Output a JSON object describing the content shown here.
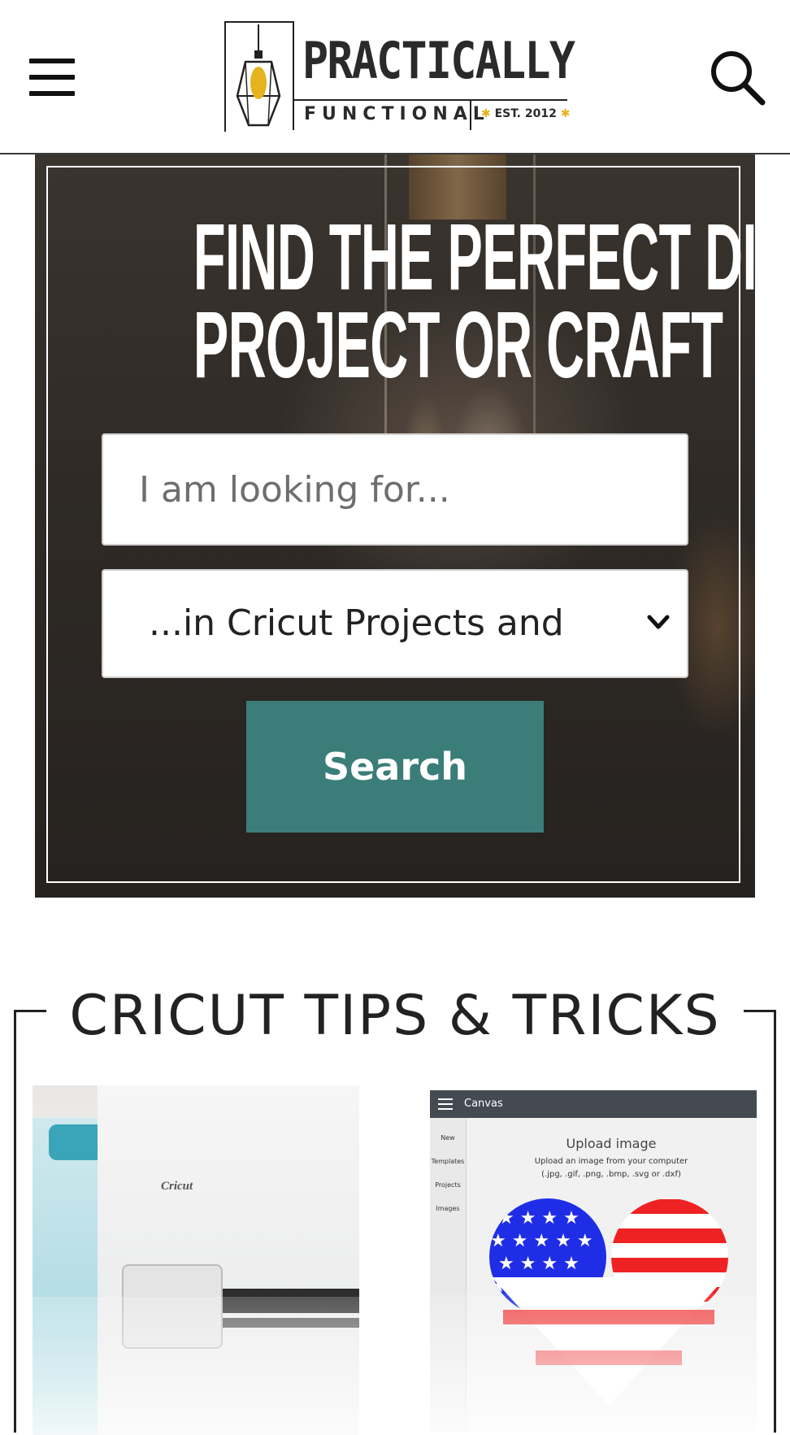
{
  "header": {
    "logo": {
      "title": "PRACTICALLY",
      "subtitle": "FUNCTIONAL",
      "established": "EST. 2012"
    },
    "colors": {
      "logo_accent": "#e6b31e",
      "text": "#2a2a2a"
    }
  },
  "hero": {
    "title_line1": "FIND THE PERFECT DIY",
    "title_line2": "PROJECT OR CRAFT",
    "search_placeholder": "I am looking for...",
    "category_select": "...in Cricut Projects and",
    "search_button": "Search",
    "colors": {
      "button": "#3b7d79"
    }
  },
  "section": {
    "title": "CRICUT TIPS & TRICKS",
    "card1": {
      "machine_brand": "Cricut"
    },
    "card2": {
      "app_bar_title": "Canvas",
      "sidebar": [
        "New",
        "Templates",
        "Projects",
        "Images"
      ],
      "upload_title": "Upload image",
      "upload_subtitle": "Upload an image from your computer",
      "upload_formats": "(.jpg, .gif, .png, .bmp, .svg or .dxf)"
    }
  },
  "icons": [
    "hamburger-menu-icon",
    "search-icon",
    "chevron-down-icon",
    "lamp-logo-icon"
  ]
}
